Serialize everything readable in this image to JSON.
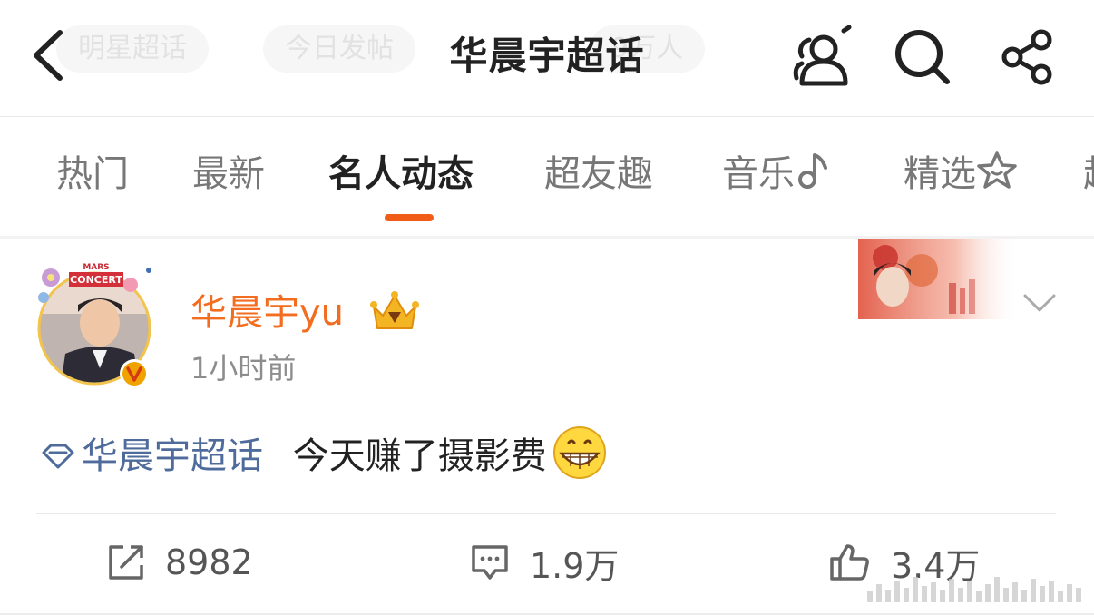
{
  "header": {
    "title": "华晨宇超话",
    "ghost_chips": [
      "明星超话",
      "今日发帖",
      "9万人"
    ],
    "icons": {
      "back": "chevron-left-icon",
      "people": "user-group-icon",
      "search": "search-icon",
      "share": "share-icon"
    }
  },
  "tabs": [
    {
      "label": "热门",
      "active": false
    },
    {
      "label": "最新",
      "active": false
    },
    {
      "label": "名人动态",
      "active": true
    },
    {
      "label": "超友趣",
      "active": false
    },
    {
      "label": "音乐",
      "active": false,
      "icon": "music-note-icon"
    },
    {
      "label": "精选",
      "active": false,
      "icon": "star-icon"
    },
    {
      "label": "超",
      "active": false
    }
  ],
  "post": {
    "username": "华晨宇yu",
    "time": "1小时前",
    "badge_icon": "crown-icon",
    "verified_icon": "verified-v-icon",
    "topic": "华晨宇超话",
    "text": "今天赚了摄影费",
    "emoji": "grinning-face-icon",
    "actions": {
      "repost": {
        "icon": "repost-icon",
        "count": "8982"
      },
      "comment": {
        "icon": "comment-icon",
        "count": "1.9万"
      },
      "like": {
        "icon": "thumbs-up-icon",
        "count": "3.4万"
      }
    }
  },
  "colors": {
    "accent": "#f25c19",
    "username": "#f26d1f",
    "topic": "#4f6b9c",
    "verified": "#f0a300"
  }
}
